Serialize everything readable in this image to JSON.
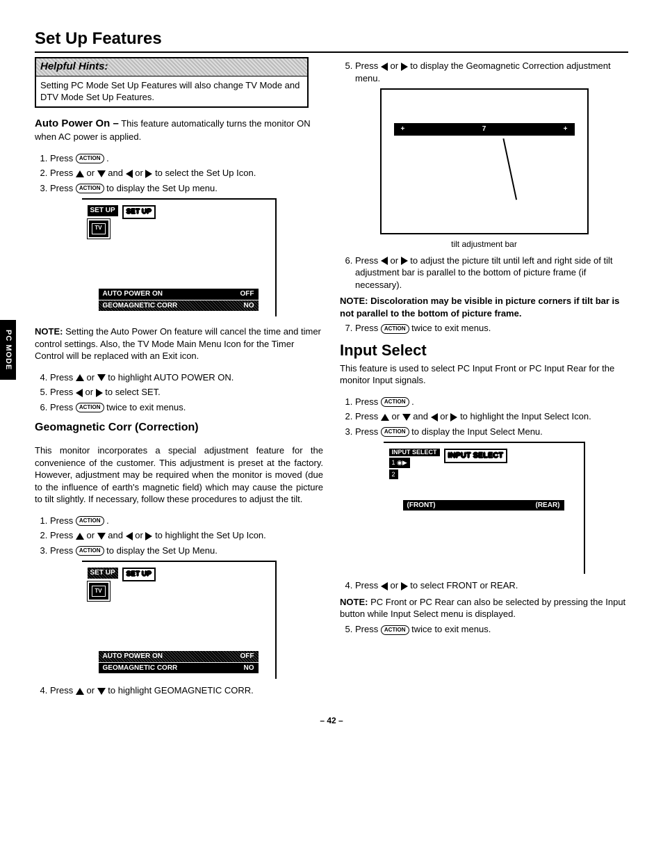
{
  "page_number": "– 42 –",
  "side_tab": "PC MODE",
  "title": "Set Up Features",
  "hints": {
    "header": "Helpful Hints:",
    "body": "Setting PC Mode Set Up Features will also change TV Mode and DTV Mode Set Up Features."
  },
  "auto_power": {
    "lead": "Auto Power On –",
    "lead_rest": "This feature automatically turns the monitor ON when AC power is applied.",
    "steps": {
      "s1a": "Press",
      "s1b": ".",
      "s2a": "Press",
      "s2b": "or",
      "s2c": "and",
      "s2d": "or",
      "s2e": "to select the Set Up Icon.",
      "s3a": "Press",
      "s3b": "to display the Set Up menu."
    },
    "note_label": "NOTE:",
    "note": "Setting the Auto Power On feature will cancel the time and timer control settings. Also, the TV Mode Main Menu Icon for the Timer Control will be replaced with an Exit icon.",
    "steps2": {
      "s4a": "Press",
      "s4b": "or",
      "s4c": "to highlight AUTO POWER ON.",
      "s5a": "Press",
      "s5b": "or",
      "s5c": "to select SET.",
      "s6a": "Press",
      "s6b": "twice to exit menus."
    }
  },
  "osd1": {
    "setup_small": "SET UP",
    "setup_big": "SET UP",
    "tv": "TV",
    "line1_l": "AUTO POWER ON",
    "line1_r": "OFF",
    "line2_l": "GEOMAGNETIC CORR",
    "line2_r": "NO"
  },
  "geo": {
    "heading": "Geomagnetic Corr (Correction)",
    "intro": "This monitor incorporates a special adjustment feature for the convenience of the customer. This adjustment is preset at the factory. However, adjustment may be required when the monitor is moved (due to the influence of earth's magnetic field) which may cause the picture to tilt slightly. If necessary, follow these procedures to adjust the tilt.",
    "steps": {
      "s1a": "Press",
      "s1b": ".",
      "s2a": "Press",
      "s2b": "or",
      "s2c": "and",
      "s2d": "or",
      "s2e": "to highlight the Set Up Icon.",
      "s3a": "Press",
      "s3b": "to display the Set Up Menu.",
      "s4a": "Press",
      "s4b": "or",
      "s4c": "to highlight GEOMAGNETIC CORR."
    }
  },
  "right": {
    "s5a": "Press",
    "s5b": "or",
    "s5c": "to display the Geomagnetic Correction adjustment menu.",
    "tilt_plus": "+",
    "tilt_val": "7",
    "tilt_caption": "tilt adjustment bar",
    "s6a": "Press",
    "s6b": "or",
    "s6c": "to adjust the picture tilt until left and right side of tilt adjustment bar is parallel to the bottom of picture frame (if necessary).",
    "note_label": "NOTE:",
    "note": "Discoloration may be visible in picture corners if tilt bar is not parallel to the bottom of picture frame.",
    "s7a": "Press",
    "s7b": "twice to exit menus."
  },
  "input": {
    "heading": "Input Select",
    "intro": "This feature is used to select PC Input Front or PC Input Rear for the monitor Input signals.",
    "steps": {
      "s1a": "Press",
      "s1b": ".",
      "s2a": "Press",
      "s2b": "or",
      "s2c": "and",
      "s2d": "or",
      "s2e": "to highlight the Input Select Icon.",
      "s3a": "Press",
      "s3b": "to display the Input Select Menu."
    },
    "osd": {
      "top1": "INPUT SELECT",
      "top2": "INPUT SELECT",
      "row1": "1 ◉▶",
      "row2": "2",
      "front": "(FRONT)",
      "rear": "(REAR)"
    },
    "steps2": {
      "s4a": "Press",
      "s4b": "or",
      "s4c": "to select FRONT or REAR.",
      "note_label": "NOTE:",
      "note": "PC Front or PC Rear can also be selected by pressing the Input button while Input Select menu is displayed.",
      "s5a": "Press",
      "s5b": "twice to exit menus."
    }
  },
  "btn_action": "ACTION"
}
